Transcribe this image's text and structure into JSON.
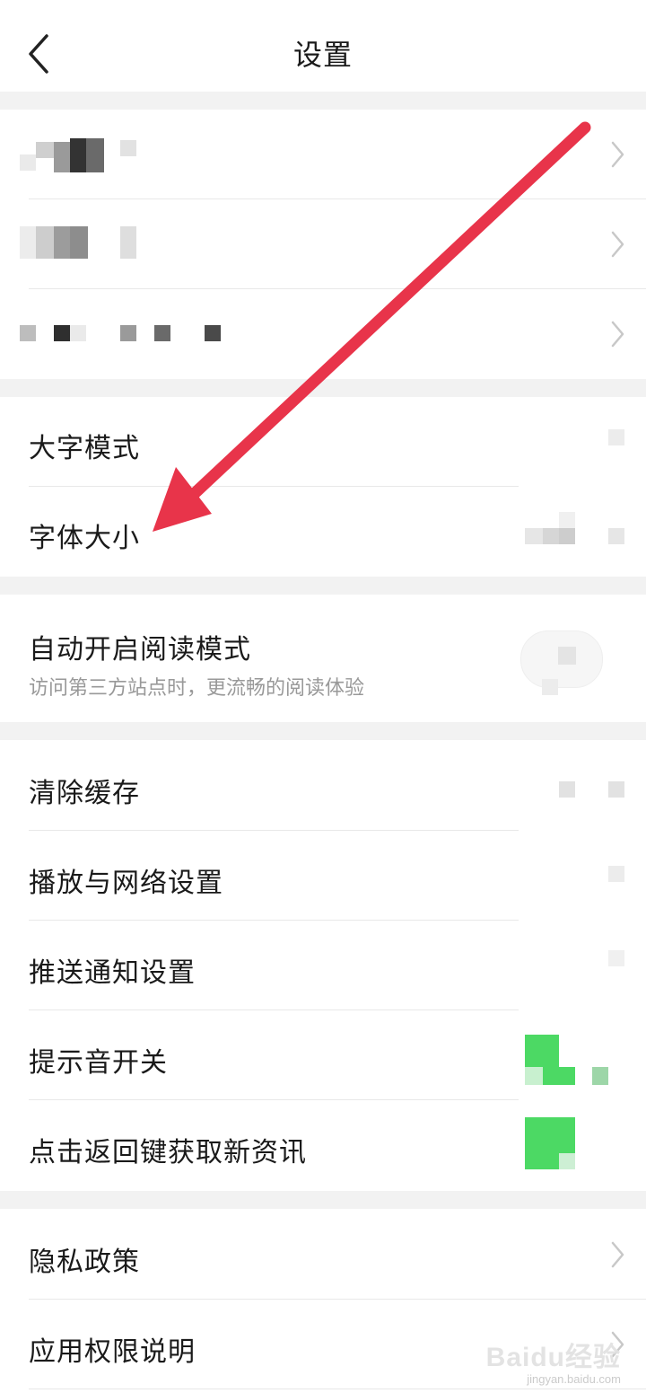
{
  "header": {
    "title": "设置"
  },
  "display": {
    "large_mode": "大字模式",
    "font_size": "字体大小"
  },
  "reading": {
    "auto_read_mode": "自动开启阅读模式",
    "auto_read_desc": "访问第三方站点时，更流畅的阅读体验"
  },
  "general": {
    "clear_cache": "清除缓存",
    "playback_network": "播放与网络设置",
    "push_notify": "推送通知设置",
    "sound_switch": "提示音开关",
    "back_key_refresh": "点击返回键获取新资讯"
  },
  "about": {
    "privacy": "隐私政策",
    "permissions": "应用权限说明"
  },
  "colors": {
    "annotation_arrow": "#e8344a",
    "toggle_on": "#4cd964",
    "background": "#f2f2f2"
  },
  "icons": [
    "back-arrow-icon",
    "chevron-right-icon",
    "annotation-arrow"
  ],
  "watermark": {
    "brand": "Baidu经验",
    "url": "jingyan.baidu.com"
  }
}
